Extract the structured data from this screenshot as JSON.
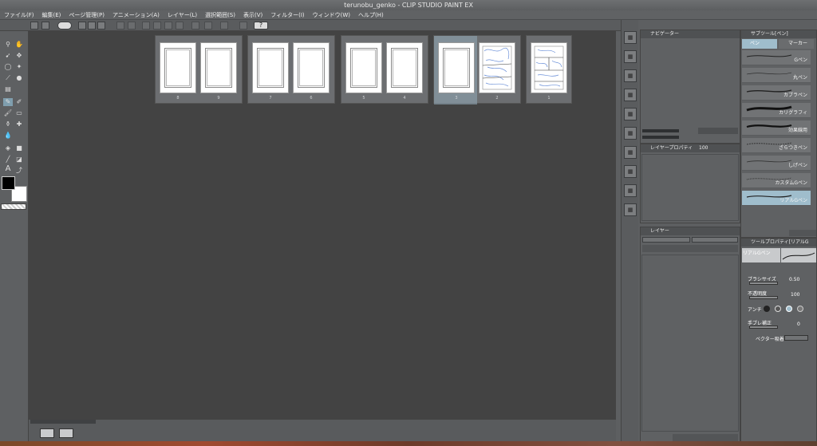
{
  "window": {
    "title": "terunobu_genko - CLIP STUDIO PAINT EX"
  },
  "menu": [
    "ファイル(F)",
    "編集(E)",
    "ページ管理(P)",
    "アニメーション(A)",
    "レイヤー(L)",
    "選択範囲(S)",
    "表示(V)",
    "フィルター(I)",
    "ウィンドウ(W)",
    "ヘルプ(H)"
  ],
  "spreads": [
    {
      "pages": [
        {
          "num": "8",
          "content": "blank"
        },
        {
          "num": "9",
          "content": "blank"
        }
      ]
    },
    {
      "pages": [
        {
          "num": "7",
          "content": "blank"
        },
        {
          "num": "6",
          "content": "blank"
        }
      ]
    },
    {
      "pages": [
        {
          "num": "5",
          "content": "blank"
        },
        {
          "num": "4",
          "content": "blank"
        }
      ]
    },
    {
      "selected": true,
      "pages": [
        {
          "num": "3",
          "content": "blank"
        },
        {
          "num": "2",
          "content": "sketch"
        }
      ]
    },
    {
      "pages": [
        {
          "num": "1",
          "content": "sketch"
        }
      ]
    }
  ],
  "navigator": {
    "title": "ナビゲーター"
  },
  "layer_property": {
    "title": "レイヤープロパティ",
    "value": "100"
  },
  "layer": {
    "tab": "レイヤー"
  },
  "subtool": {
    "title": "サブツール[ペン]",
    "tabs": [
      "ペン",
      "マーカー"
    ],
    "brushes": [
      "Gペン",
      "丸ペン",
      "カブラペン",
      "カリグラフィ",
      "効果線用",
      "ざらつきペン",
      "しげペン",
      "カスタムGペン",
      "リアルGペン"
    ],
    "selected_index": 8
  },
  "tool_property": {
    "title": "ツールプロパティ[リアルG",
    "preview_label": "リアルGペン",
    "brush_size_label": "ブラシサイズ",
    "brush_size": "0.50",
    "opacity_label": "不透明度",
    "opacity": "100",
    "aa_label": "アンチ",
    "stabilization_label": "手ブレ補正",
    "stabilization": "0",
    "vector_label": "ベクター吸着"
  },
  "colors": {
    "main": "#000000",
    "sub": "#ffffff",
    "selected_brush": "#9fbdcc",
    "canvas_bg": "#434343"
  }
}
